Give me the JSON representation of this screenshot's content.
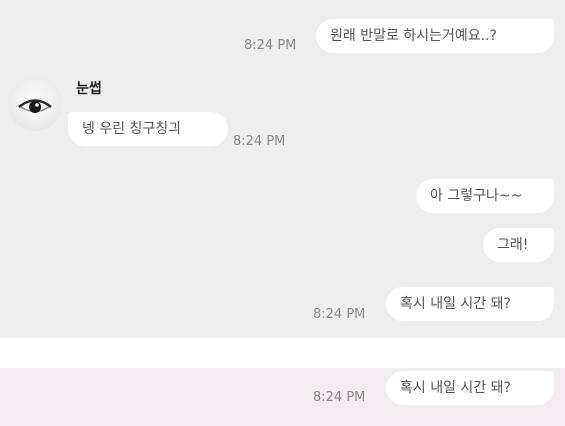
{
  "chat": {
    "messages": [
      {
        "direction": "out",
        "text": "원래 반말로 하시는거예요..?",
        "time": "8:24 PM"
      },
      {
        "direction": "in",
        "sender": "눈썹",
        "text": "넹 우린 칭구칭긔",
        "time": "8:24 PM"
      },
      {
        "direction": "out",
        "text": "아 그렇구나~~"
      },
      {
        "direction": "out",
        "text": "그래!"
      },
      {
        "direction": "out",
        "text": "혹시 내일 시간 돼?",
        "time": "8:24 PM"
      }
    ]
  },
  "chat2": {
    "messages": [
      {
        "direction": "out",
        "text": "혹시 내일 시간 돼?",
        "time": "8:24 PM"
      }
    ]
  }
}
